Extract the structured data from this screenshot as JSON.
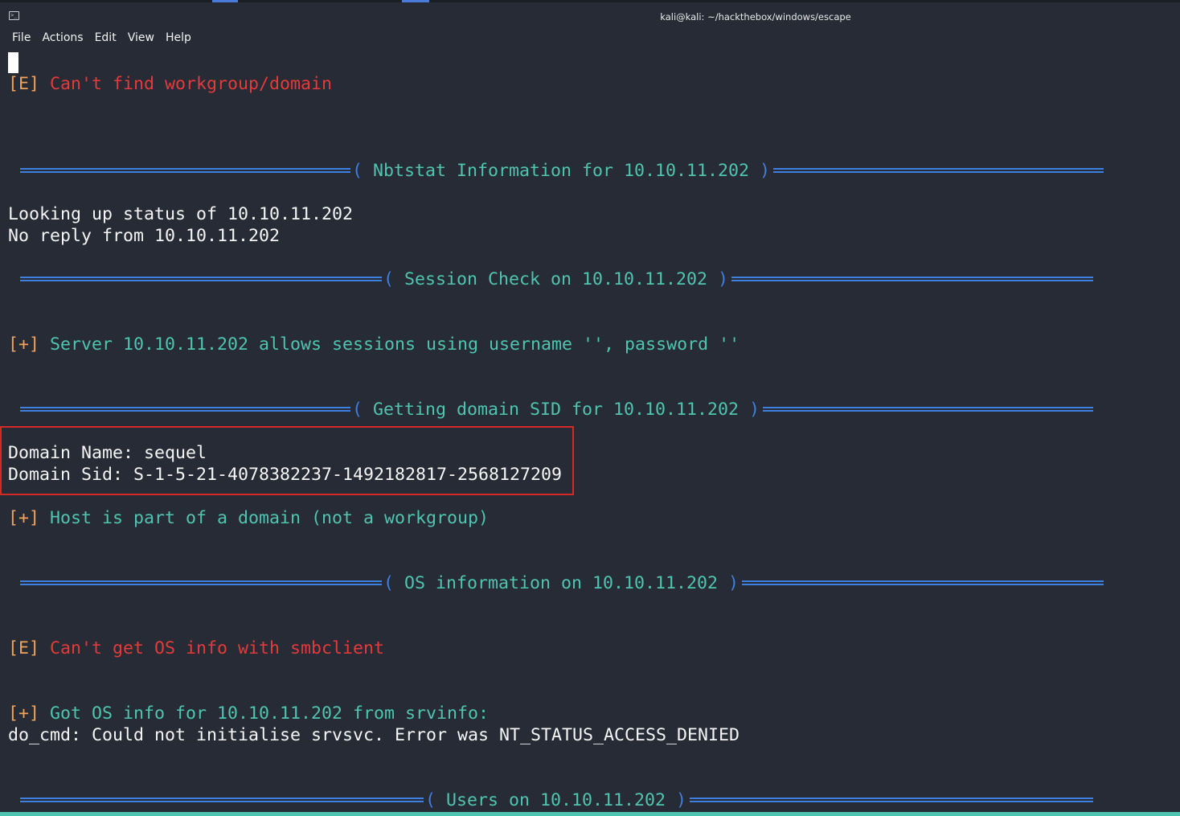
{
  "window": {
    "title": "kali@kali: ~/hackthebox/windows/escape"
  },
  "menu": {
    "items": [
      "File",
      "Actions",
      "Edit",
      "View",
      "Help"
    ]
  },
  "terminal": {
    "err_workgroup": {
      "tag": "[E]",
      "text": "Can't find workgroup/domain"
    },
    "banner_nbtstat": {
      "open": "(",
      "text": " Nbtstat Information for 10.10.11.202 ",
      "close": ")"
    },
    "nbt_line1": "Looking up status of 10.10.11.202",
    "nbt_line2": "No reply from 10.10.11.202",
    "banner_session": {
      "open": "(",
      "text": " Session Check on 10.10.11.202 ",
      "close": ")"
    },
    "session_ok": {
      "tag": "[+]",
      "text": "Server 10.10.11.202 allows sessions using username '', password ''"
    },
    "banner_sid": {
      "open": "(",
      "text": " Getting domain SID for 10.10.11.202 ",
      "close": ")"
    },
    "domain_name": "Domain Name: sequel",
    "domain_sid": "Domain Sid: S-1-5-21-4078382237-1492182817-2568127209",
    "host_domain": {
      "tag": "[+]",
      "text": "Host is part of a domain (not a workgroup)"
    },
    "banner_os": {
      "open": "(",
      "text": " OS information on 10.10.11.202 ",
      "close": ")"
    },
    "err_os": {
      "tag": "[E]",
      "text": "Can't get OS info with smbclient"
    },
    "os_ok": {
      "tag": "[+]",
      "text": "Got OS info for 10.10.11.202 from srvinfo:"
    },
    "do_cmd": "do_cmd: Could not initialise srvsvc. Error was NT_STATUS_ACCESS_DENIED",
    "banner_users": {
      "open": "(",
      "text": " Users on 10.10.11.202 ",
      "close": ")"
    }
  },
  "colors": {
    "background": "#262b35",
    "bracket": "#f0a35e",
    "error": "#e43a3a",
    "success": "#4fc4b0",
    "rule": "#3f7fe0",
    "highlight_box": "#d72828"
  }
}
